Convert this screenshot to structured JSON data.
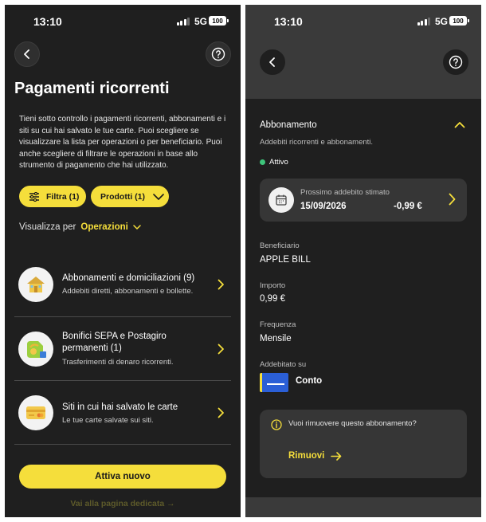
{
  "left": {
    "status": {
      "time": "13:10",
      "network": "5G",
      "battery": "100"
    },
    "title": "Pagamenti ricorrenti",
    "intro": "Tieni sotto controllo i pagamenti ricorrenti, abbonamenti e i siti su cui hai salvato le tue carte. Puoi scegliere se visualizzare la lista per operazioni o per beneficiario. Puoi anche scegliere di filtrare le operazioni in base allo strumento di pagamento che hai utilizzato.",
    "filters": {
      "filter_label": "Filtra (1)",
      "products_label": "Prodotti (1)"
    },
    "view_by": {
      "label": "Visualizza per",
      "value": "Operazioni"
    },
    "items": [
      {
        "title": "Abbonamenti e domiciliazioni (9)",
        "subtitle": "Addebiti diretti, abbonamenti e bollette."
      },
      {
        "title": "Bonifici SEPA e Postagiro permanenti (1)",
        "subtitle": "Trasferimenti di denaro ricorrenti."
      },
      {
        "title": "Siti in cui hai salvato le carte",
        "subtitle": "Le tue carte salvate sui siti."
      }
    ],
    "primary_button": "Attiva nuovo",
    "secondary_link": "Vai alla pagina dedicata"
  },
  "right": {
    "status": {
      "time": "13:10",
      "network": "5G",
      "battery": "100"
    },
    "section_title": "Abbonamento",
    "section_subtitle": "Addebiti ricorrenti e abbonamenti.",
    "status_label": "Attivo",
    "next_charge": {
      "label": "Prossimo addebito stimato",
      "date": "15/09/2026",
      "amount": "-0,99 €"
    },
    "fields": {
      "beneficiary_label": "Beneficiario",
      "beneficiary_value": "APPLE BILL",
      "amount_label": "Importo",
      "amount_value": "0,99 €",
      "frequency_label": "Frequenza",
      "frequency_value": "Mensile",
      "charged_label": "Addebitato su",
      "charged_value": "Conto"
    },
    "remove_box": {
      "question": "Vuoi rimuovere questo abbonamento?",
      "action": "Rimuovi"
    }
  },
  "colors": {
    "accent": "#f5de3b",
    "background": "#1f1f1f",
    "active": "#3ec57b"
  }
}
